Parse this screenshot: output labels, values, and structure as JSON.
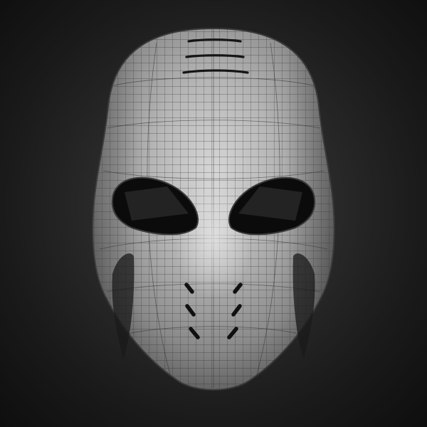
{
  "scene": {
    "subject": "mask-3d-wireframe",
    "colors": {
      "background_center": "#3a3a3a",
      "background_edge": "#0e0e0e",
      "mesh_fill_light": "#d9d9d9",
      "mesh_fill_mid": "#9a9a9a",
      "mesh_fill_dark": "#4f4f4f",
      "wireframe": "#2c2c2c",
      "detail_dark": "#1a1a1a"
    },
    "features": [
      "forehead-vents",
      "eye-sockets",
      "nose-bridge",
      "mouth-vent-slots",
      "cheek-vents"
    ]
  }
}
